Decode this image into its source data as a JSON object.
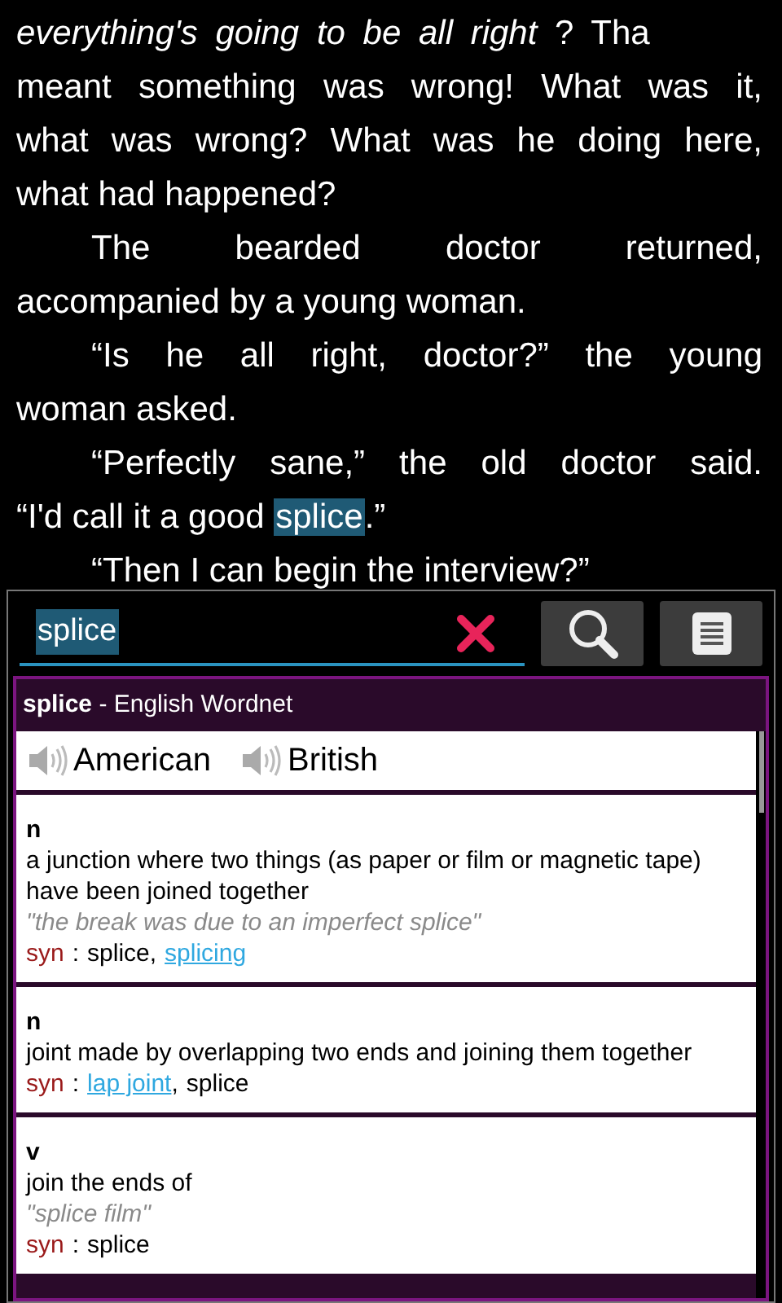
{
  "book": {
    "first_line": "*everything's going to be all right* ? Tha",
    "paragraphs": [
      {
        "indent": false,
        "lines": [
          {
            "text": "meant something was wrong! What was it,"
          },
          {
            "text": "what was wrong? What was he doing here,"
          },
          {
            "text": "what had happened?"
          }
        ]
      },
      {
        "indent": true,
        "lines": [
          {
            "text": "The bearded doctor returned,"
          },
          {
            "text": "accompanied by a young woman."
          }
        ]
      },
      {
        "indent": true,
        "lines": [
          {
            "text": "“Is he all right, doctor?” the young"
          },
          {
            "text": "woman asked."
          }
        ]
      },
      {
        "indent": true,
        "lines": [
          {
            "text": "“Perfectly sane,” the old doctor said."
          },
          {
            "text": "“I'd call it a good ",
            "highlight": "splice",
            "after": ".”"
          }
        ]
      },
      {
        "indent": true,
        "lines": [
          {
            "text": "“Then I can begin the interview?”"
          }
        ]
      }
    ]
  },
  "lookup": {
    "query": "splice",
    "dictionary_word": "splice",
    "dictionary_name": " - English Wordnet",
    "pronunciations": [
      "American",
      "British"
    ],
    "entries": [
      {
        "pos": "n",
        "definition": "a junction where two things (as paper or film or magnetic tape) have been joined together",
        "example": "\"the break was due to an imperfect splice\"",
        "syn_label": "syn",
        "syn_separator": ":",
        "list_separator": ",",
        "synonyms": [
          {
            "text": "splice",
            "link": false
          },
          {
            "text": "splicing",
            "link": true
          }
        ]
      },
      {
        "pos": "n",
        "definition": "joint made by overlapping two ends and joining them together",
        "syn_label": "syn",
        "syn_separator": ":",
        "list_separator": ",",
        "synonyms": [
          {
            "text": "lap joint",
            "link": true
          },
          {
            "text": "splice",
            "link": false
          }
        ]
      },
      {
        "pos": "v",
        "definition": "join the ends of",
        "example": "\"splice film\"",
        "syn_label": "syn",
        "syn_separator": ":",
        "synonyms": [
          {
            "text": "splice",
            "link": false
          }
        ]
      }
    ]
  }
}
